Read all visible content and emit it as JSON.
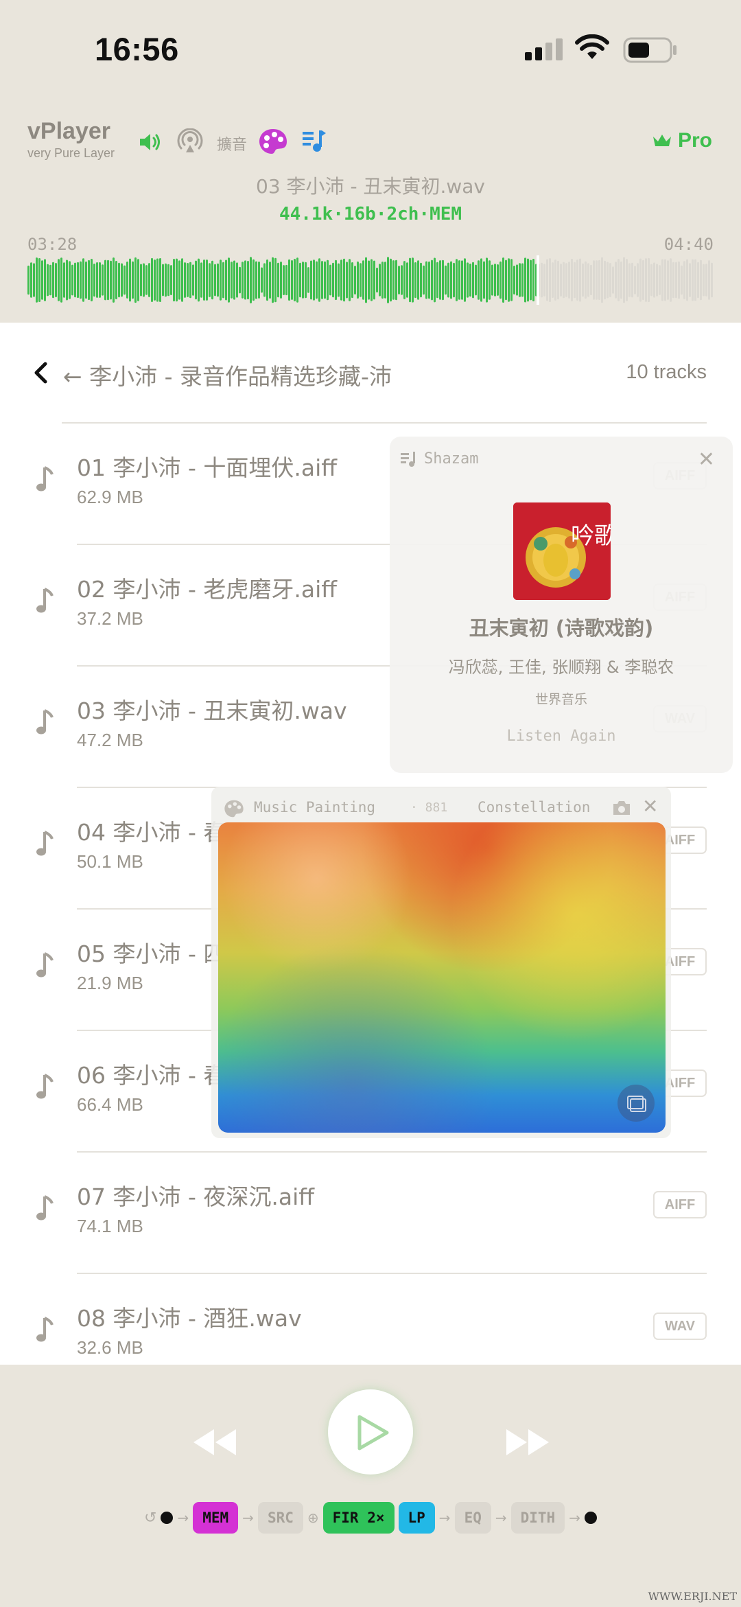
{
  "status": {
    "time": "16:56"
  },
  "header": {
    "app_name": "vPlayer",
    "app_sub": "very Pure Layer",
    "kuoyin": "擴音",
    "pro_label": "Pro",
    "now_playing": "03 李小沛 - 丑末寅初.wav",
    "format": "44.1k·16b·2ch·MEM",
    "time_current": "03:28",
    "time_total": "04:40",
    "progress_fraction": 0.742,
    "accent_color": "#3fbf4f"
  },
  "list": {
    "title": "← 李小沛 - 录音作品精选珍藏-沛",
    "count": "10 tracks",
    "tracks": [
      {
        "name": "01 李小沛 - 十面埋伏.aiff",
        "size": "62.9 MB",
        "badge": "AIFF"
      },
      {
        "name": "02 李小沛 - 老虎磨牙.aiff",
        "size": "37.2 MB",
        "badge": "AIFF"
      },
      {
        "name": "03 李小沛 - 丑末寅初.wav",
        "size": "47.2 MB",
        "badge": "WAV"
      },
      {
        "name": "04 李小沛 - 春",
        "size": "50.1 MB",
        "badge": "AIFF"
      },
      {
        "name": "05 李小沛 - 四",
        "size": "21.9 MB",
        "badge": "AIFF"
      },
      {
        "name": "06 李小沛 - 春风翠竹.aiff",
        "size": "66.4 MB",
        "badge": "AIFF"
      },
      {
        "name": "07 李小沛 - 夜深沉.aiff",
        "size": "74.1 MB",
        "badge": "AIFF"
      },
      {
        "name": "08 李小沛 - 酒狂.wav",
        "size": "32.6 MB",
        "badge": "WAV"
      }
    ]
  },
  "shazam": {
    "title": "Shazam",
    "song": "丑末寅初 (诗歌戏韵)",
    "artists": "冯欣蕊, 王佳, 张顺翔 & 李聪农",
    "label": "世界音乐",
    "listen_again": "Listen Again",
    "album_art_text": "吟歌"
  },
  "painting": {
    "title": "Music Painting",
    "number": "· 881",
    "mode": "Constellation"
  },
  "chain": {
    "items": [
      {
        "label": "MEM",
        "bg": "#d431d4",
        "fg": "#111111"
      },
      {
        "label": "SRC",
        "bg": "#dcd8d0",
        "fg": "#a7a29a"
      },
      {
        "label": "FIR 2×",
        "bg": "#2fc25a",
        "fg": "#111111"
      },
      {
        "label": "LP",
        "bg": "#22b8e6",
        "fg": "#111111"
      },
      {
        "label": "EQ",
        "bg": "#dcd8d0",
        "fg": "#a7a29a"
      },
      {
        "label": "DITH",
        "bg": "#dcd8d0",
        "fg": "#a7a29a"
      }
    ]
  },
  "watermark": "WWW.ERJI.NET"
}
